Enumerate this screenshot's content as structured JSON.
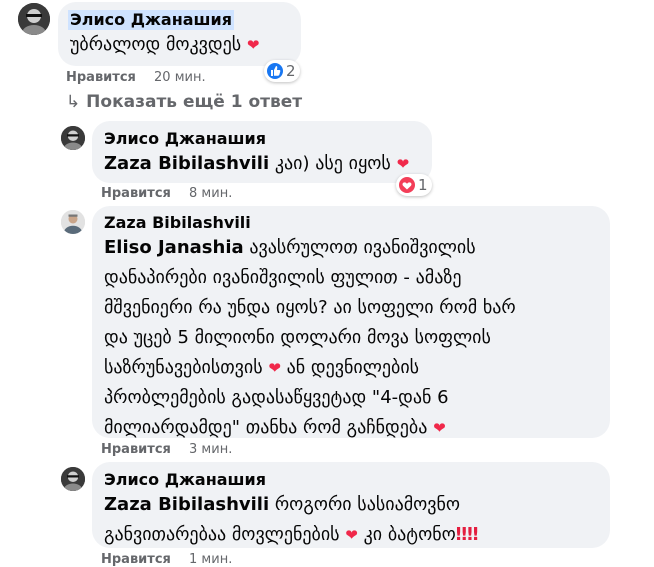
{
  "comments": [
    {
      "author": "Элисо Джанашия",
      "text": "უბრალოდ მოკვდეს",
      "like_label": "Нравится",
      "time": "20 мин.",
      "reaction_count": "2",
      "reaction_icon": "like-icon"
    },
    {
      "author": "Элисо Джанашия",
      "mention": "Zaza Bibilashvili",
      "text": "კაი) ასე იყოს",
      "like_label": "Нравится",
      "time": "8 мин.",
      "reaction_count": "1",
      "reaction_icon": "love-icon"
    },
    {
      "author": "Zaza Bibilashvili",
      "mention": "Eliso Janashia",
      "lines": [
        "ავასრულოთ ივანიშვილის",
        "დანაპირები ივანიშვილის ფულით - ამაზე",
        "მშვენიერი რა უნდა იყოს? აი სოფელი რომ ხარ",
        "და უცებ 5 მილიონი დოლარი მოვა სოფლის",
        "საზრუნავებისთვის",
        "ან დევნილების",
        "პრობლემების გადასაწყვეტად \"4-დან 6",
        "მილიარდამდე\" თანხა რომ გაჩნდება"
      ],
      "like_label": "Нравится",
      "time": "3 мин."
    },
    {
      "author": "Элисо Джанашия",
      "mention": "Zaza Bibilashvili",
      "line1": "როგორი სასიამოვნო",
      "line2a": "განვითარებაა მოვლენების",
      "line2b": "კი ბატონო",
      "like_label": "Нравится",
      "time": "1 мин."
    }
  ],
  "show_more": "Показать ещё 1 ответ",
  "colors": {
    "bubble": "#f0f2f5",
    "heart": "#f0284a",
    "like_blue": "#1877f2",
    "meta": "#65676b",
    "highlight": "#cfe3ff"
  }
}
